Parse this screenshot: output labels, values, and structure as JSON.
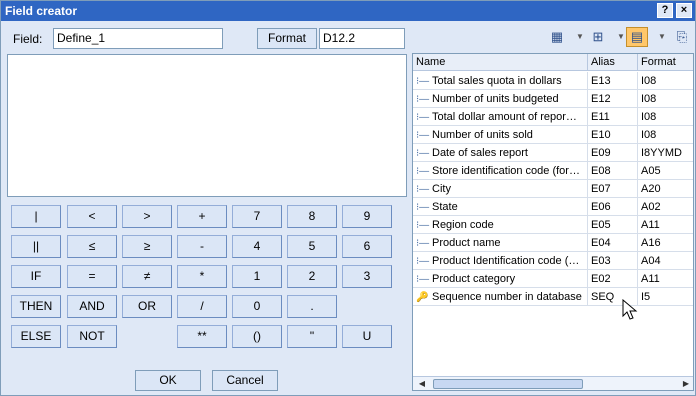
{
  "window": {
    "title": "Field creator",
    "help_label": "?",
    "close_label": "×"
  },
  "field": {
    "label": "Field:",
    "value": "Define_1",
    "format_button": "Format",
    "format_value": "D12.2"
  },
  "toolbar": {
    "icons": [
      "table-icon",
      "tree-icon",
      "grid-icon",
      "export-icon"
    ]
  },
  "keypad": {
    "row1": [
      "|",
      "<",
      ">",
      "+",
      "7",
      "8",
      "9"
    ],
    "row2": [
      "||",
      "≤",
      "≥",
      "-",
      "4",
      "5",
      "6"
    ],
    "row3": [
      "IF",
      "=",
      "≠",
      "*",
      "1",
      "2",
      "3"
    ],
    "row4": [
      "THEN",
      "AND",
      "OR",
      "/",
      "0",
      "."
    ],
    "row5": [
      "ELSE",
      "NOT",
      "**",
      "()",
      "\"",
      "U"
    ]
  },
  "buttons": {
    "ok": "OK",
    "cancel": "Cancel"
  },
  "table": {
    "headers": [
      "Name",
      "Alias",
      "Format"
    ],
    "rows": [
      {
        "name": "Total sales quota in dollars",
        "alias": "E13",
        "format": "I08"
      },
      {
        "name": "Number of units budgeted",
        "alias": "E12",
        "format": "I08"
      },
      {
        "name": "Total dollar amount of repor…",
        "alias": "E11",
        "format": "I08"
      },
      {
        "name": "Number of units sold",
        "alias": "E10",
        "format": "I08"
      },
      {
        "name": "Date of sales report",
        "alias": "E09",
        "format": "I8YYMD"
      },
      {
        "name": "Store identification code (for…",
        "alias": "E08",
        "format": "A05"
      },
      {
        "name": "City",
        "alias": "E07",
        "format": "A20"
      },
      {
        "name": "State",
        "alias": "E06",
        "format": "A02"
      },
      {
        "name": "Region code",
        "alias": "E05",
        "format": "A11"
      },
      {
        "name": "Product name",
        "alias": "E04",
        "format": "A16"
      },
      {
        "name": "Product Identification code (…",
        "alias": "E03",
        "format": "A04"
      },
      {
        "name": "Product category",
        "alias": "E02",
        "format": "A11"
      },
      {
        "name": "Sequence number in database",
        "alias": "SEQ",
        "format": "I5"
      }
    ]
  }
}
